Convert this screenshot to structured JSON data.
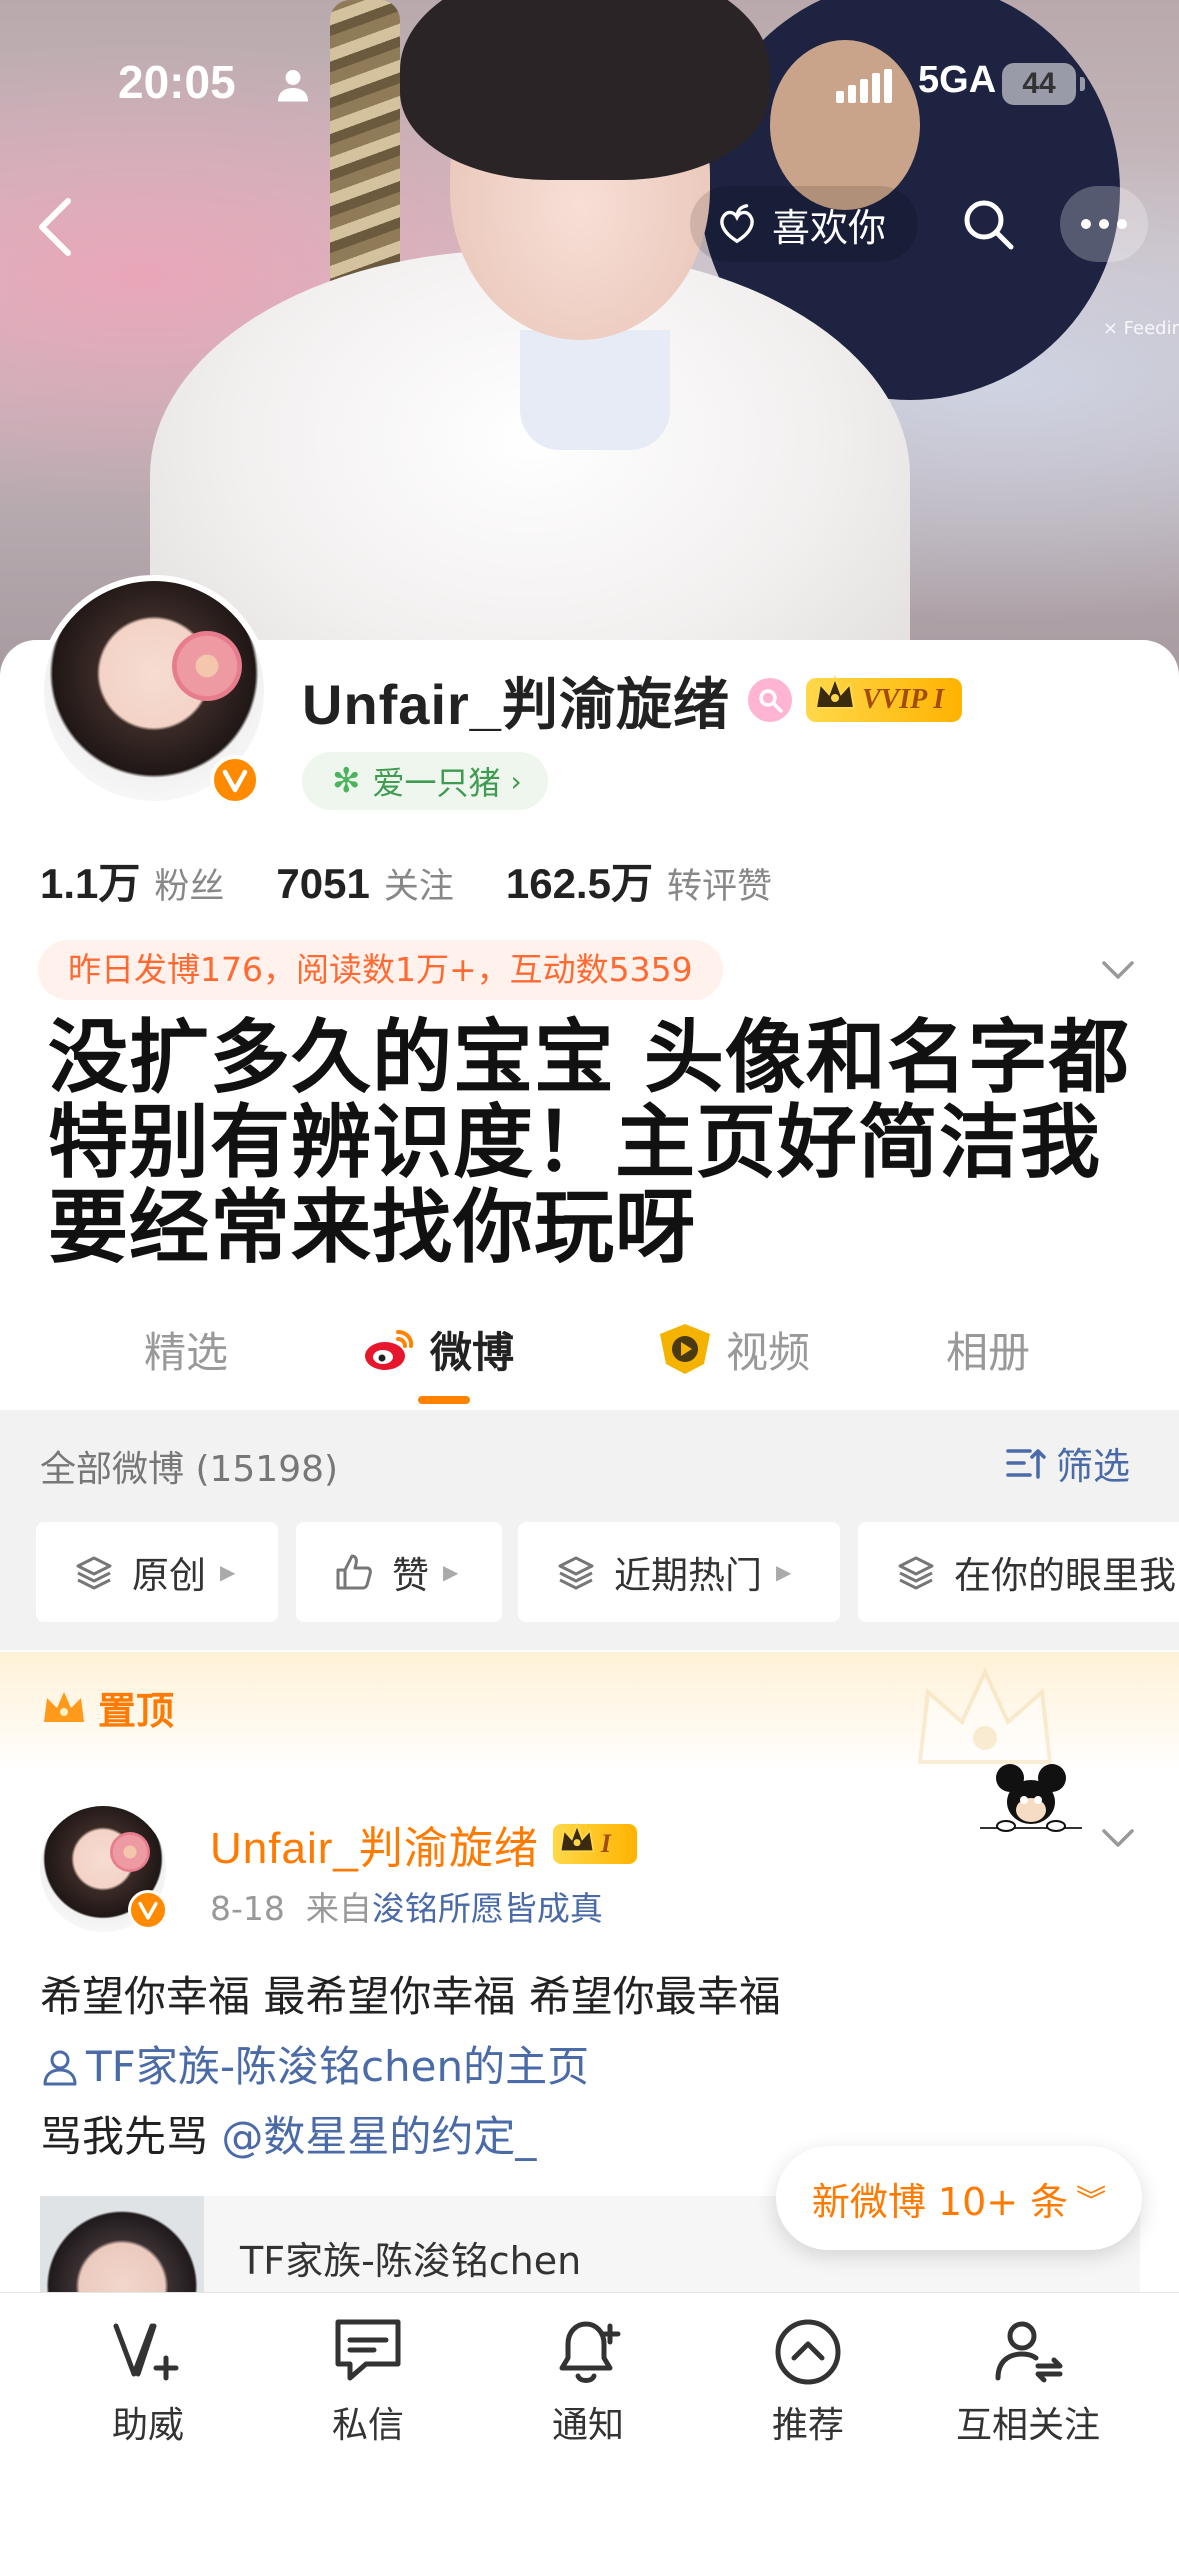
{
  "status_bar": {
    "time": "20:05",
    "network": "5GA",
    "battery": "44"
  },
  "cover": {
    "watermark": "× Feedir"
  },
  "top_nav": {
    "like_label": "喜欢你"
  },
  "profile": {
    "name": "Unfair_判渝旋绪",
    "vip_badge": "VVIP I",
    "fan_group": "爱一只猪",
    "stats": [
      {
        "value": "1.1万",
        "label": "粉丝"
      },
      {
        "value": "7051",
        "label": "关注"
      },
      {
        "value": "162.5万",
        "label": "转评赞"
      }
    ],
    "summary": "昨日发博176，阅读数1万+，互动数5359",
    "bio": "没扩多久的宝宝 头像和名字都特别有辨识度！主页好简洁我要经常来找你玩呀"
  },
  "tabs": [
    {
      "label": "精选",
      "active": false
    },
    {
      "label": "微博",
      "active": true
    },
    {
      "label": "视频",
      "active": false
    },
    {
      "label": "相册",
      "active": false
    }
  ],
  "feed": {
    "count_label": "全部微博 (15198)",
    "filter_label": "筛选",
    "chips": [
      "原创",
      "赞",
      "近期热门",
      "在你的眼里我"
    ]
  },
  "pinned": {
    "label": "置顶"
  },
  "post": {
    "author": "Unfair_判渝旋绪",
    "vip_badge": "I",
    "date": "8-18",
    "source_prefix": "来自",
    "source": "浚铭所愿皆成真",
    "line1": "希望你幸福 最希望你幸福 希望你最幸福",
    "profile_link": "TF家族-陈浚铭chen的主页",
    "line3_text": "骂我先骂 ",
    "mention": "@数星星的约定_",
    "embed_title": "TF家族-陈浚铭chen"
  },
  "new_posts_pill": "新微博 10+ 条",
  "bottom_toolbar": [
    "助威",
    "私信",
    "通知",
    "推荐",
    "互相关注"
  ],
  "colors": {
    "accent": "#ff7a00",
    "link": "#4a6ba8",
    "summary_bg": "#fff1ec",
    "fan_tag_text": "#3e9b4f"
  }
}
